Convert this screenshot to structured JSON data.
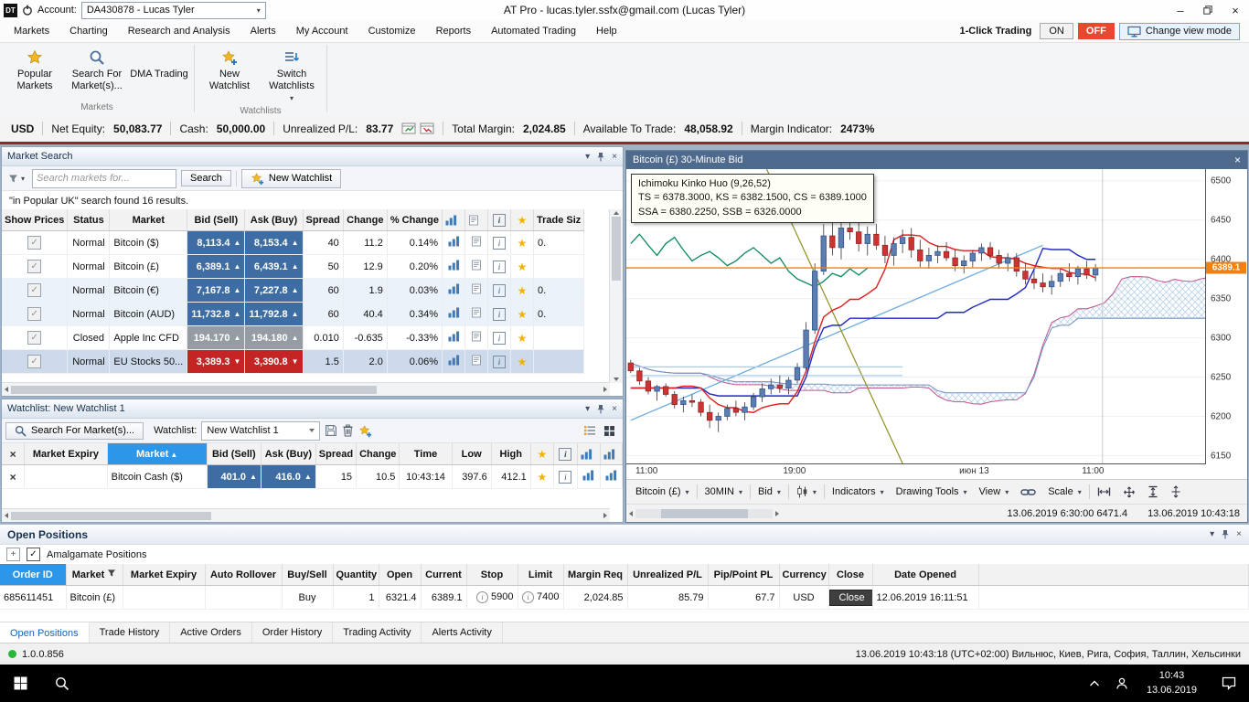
{
  "icons": {
    "up_triangle": "▲",
    "down_triangle": "▼",
    "dropdown_caret": "▾",
    "close": "×",
    "minimize": "–",
    "star": "★",
    "info": "i",
    "check": "✓",
    "plus": "+",
    "row_delete": "×"
  },
  "window": {
    "logo": "DT",
    "account_label": "Account:",
    "account_value": "DA430878 -  Lucas Tyler",
    "title": "AT Pro - lucas.tyler.ssfx@gmail.com (Lucas Tyler)"
  },
  "menubar": {
    "items": [
      "Markets",
      "Charting",
      "Research and Analysis",
      "Alerts",
      "My Account",
      "Customize",
      "Reports",
      "Automated Trading",
      "Help"
    ],
    "one_click_label": "1-Click Trading",
    "on_label": "ON",
    "off_label": "OFF",
    "change_view_label": "Change view mode"
  },
  "ribbon": {
    "groups": [
      "Markets",
      "Watchlists"
    ],
    "buttons": [
      {
        "label": "Popular Markets",
        "icon": "popular",
        "group": "Markets"
      },
      {
        "label": "Search For Market(s)...",
        "icon": "search",
        "group": "Markets"
      },
      {
        "label": "DMA Trading",
        "icon": "none",
        "group": "Markets"
      },
      {
        "label": "New Watchlist",
        "icon": "starplus",
        "group": "Watchlists"
      },
      {
        "label": "Switch Watchlists",
        "icon": "switch",
        "group": "Watchlists",
        "caret": true
      }
    ]
  },
  "account_bar": {
    "currency": "USD",
    "net_equity_label": "Net Equity:",
    "net_equity": "50,083.77",
    "cash_label": "Cash:",
    "cash": "50,000.00",
    "unrealized_label": "Unrealized P/L:",
    "unrealized": "83.77",
    "total_margin_label": "Total Margin:",
    "total_margin": "2,024.85",
    "available_label": "Available To Trade:",
    "available": "48,058.92",
    "margin_label": "Margin Indicator:",
    "margin": "2473%"
  },
  "market_search": {
    "title": "Market Search",
    "search_placeholder": "Search markets for...",
    "search_button": "Search",
    "new_watchlist_button": "New Watchlist",
    "result_text": "\"in Popular UK\" search found 16 results.",
    "columns": [
      "Show Prices",
      "Status",
      "Market",
      "Bid (Sell)",
      "Ask (Buy)",
      "Spread",
      "Change",
      "% Change",
      "",
      "",
      "",
      "",
      "Trade Siz"
    ],
    "rows": [
      {
        "status": "Normal",
        "market": "Bitcoin ($)",
        "bid": "8,113.4",
        "ask": "8,153.4",
        "dir": "up",
        "spread": "40",
        "change": "11.2",
        "pct": "0.14%",
        "trade": "0."
      },
      {
        "status": "Normal",
        "market": "Bitcoin (£)",
        "bid": "6,389.1",
        "ask": "6,439.1",
        "dir": "up",
        "spread": "50",
        "change": "12.9",
        "pct": "0.20%",
        "trade": ""
      },
      {
        "status": "Normal",
        "market": "Bitcoin (€)",
        "bid": "7,167.8",
        "ask": "7,227.8",
        "dir": "up",
        "spread": "60",
        "change": "1.9",
        "pct": "0.03%",
        "trade": "0.",
        "shaded": true
      },
      {
        "status": "Normal",
        "market": "Bitcoin (AUD)",
        "bid": "11,732.8",
        "ask": "11,792.8",
        "dir": "up",
        "spread": "60",
        "change": "40.4",
        "pct": "0.34%",
        "trade": "0.",
        "shaded": true
      },
      {
        "status": "Closed",
        "market": "Apple Inc CFD",
        "bid": "194.170",
        "ask": "194.180",
        "dir": "closed",
        "spread": "0.010",
        "change": "-0.635",
        "pct": "-0.33%",
        "trade": ""
      },
      {
        "status": "Normal",
        "market": "EU Stocks 50...",
        "bid": "3,389.3",
        "ask": "3,390.8",
        "dir": "down",
        "spread": "1.5",
        "change": "2.0",
        "pct": "0.06%",
        "trade": "",
        "selected": true
      }
    ]
  },
  "watchlist": {
    "title": "Watchlist: New Watchlist 1",
    "search_button": "Search For Market(s)...",
    "watchlist_label": "Watchlist:",
    "watchlist_value": "New Watchlist 1",
    "columns": [
      "",
      "Market Expiry",
      "Market",
      "Bid (Sell)",
      "Ask (Buy)",
      "Spread",
      "Change",
      "Time",
      "Low",
      "High"
    ],
    "rows": [
      {
        "expiry": "",
        "market": "Bitcoin Cash ($)",
        "bid": "401.0",
        "ask": "416.0",
        "dir": "up",
        "spread": "15",
        "change": "10.5",
        "time": "10:43:14",
        "low": "397.6",
        "high": "412.1"
      }
    ]
  },
  "chart": {
    "title": "Bitcoin (£) 30-Minute Bid",
    "tooltip": {
      "line1": "Ichimoku Kinko Huo (9,26,52)",
      "line2": "TS = 6378.3000, KS = 6382.1500, CS = 6389.1000",
      "line3": "SSA = 6380.2250, SSB = 6326.0000"
    },
    "price_label": "6389.1",
    "toolbar": {
      "market": "Bitcoin (£)",
      "timeframe": "30MIN",
      "price_type": "Bid",
      "indicators": "Indicators",
      "drawing_tools": "Drawing Tools",
      "view": "View",
      "scale": "Scale"
    },
    "status_left": "13.06.2019 6:30:00 6471.4",
    "status_right": "13.06.2019 10:43:18",
    "chart_data": {
      "type": "candlestick",
      "title": "Bitcoin (£) 30-Minute Bid",
      "indicator": "Ichimoku Kinko Huo (9,26,52)",
      "current_price": 6389.1,
      "ylim": [
        6140,
        6515
      ],
      "y_ticks": [
        6500,
        6450,
        6400,
        6350,
        6300,
        6250,
        6200,
        6150
      ],
      "x_labels": [
        {
          "label": "11:00",
          "pos": 0.035
        },
        {
          "label": "19:00",
          "pos": 0.29
        },
        {
          "label": "июн 13",
          "pos": 0.6
        },
        {
          "label": "11:00",
          "pos": 0.805
        }
      ],
      "total_slots": 66,
      "pre_candles": [
        [
          6270,
          6280,
          6255,
          6260
        ],
        [
          6260,
          6272,
          6248,
          6255
        ],
        [
          6255,
          6265,
          6240,
          6250
        ],
        [
          6250,
          6260,
          6235,
          6245
        ],
        [
          6245,
          6258,
          6232,
          6240
        ],
        [
          6240,
          6255,
          6230,
          6248
        ],
        [
          6248,
          6260,
          6238,
          6252
        ],
        [
          6252,
          6265,
          6242,
          6248
        ],
        [
          6248,
          6258,
          6232,
          6238
        ],
        [
          6238,
          6250,
          6225,
          6232
        ],
        [
          6232,
          6245,
          6218,
          6225
        ],
        [
          6225,
          6238,
          6212,
          6220
        ],
        [
          6220,
          6235,
          6208,
          6228
        ],
        [
          6228,
          6242,
          6218,
          6235
        ],
        [
          6235,
          6248,
          6222,
          6230
        ],
        [
          6230,
          6240,
          6215,
          6222
        ],
        [
          6222,
          6235,
          6210,
          6218
        ],
        [
          6218,
          6230,
          6205,
          6212
        ],
        [
          6212,
          6228,
          6202,
          6220
        ],
        [
          6220,
          6235,
          6210,
          6228
        ],
        [
          6228,
          6240,
          6215,
          6222
        ],
        [
          6222,
          6232,
          6208,
          6215
        ],
        [
          6215,
          6228,
          6205,
          6210
        ],
        [
          6210,
          6225,
          6200,
          6218
        ],
        [
          6218,
          6232,
          6208,
          6225
        ],
        [
          6225,
          6238,
          6212,
          6230
        ]
      ],
      "candles": [
        [
          6268,
          6272,
          6255,
          6258
        ],
        [
          6258,
          6262,
          6240,
          6245
        ],
        [
          6245,
          6250,
          6228,
          6232
        ],
        [
          6232,
          6240,
          6220,
          6238
        ],
        [
          6238,
          6242,
          6225,
          6228
        ],
        [
          6228,
          6232,
          6210,
          6215
        ],
        [
          6215,
          6225,
          6205,
          6220
        ],
        [
          6220,
          6228,
          6212,
          6218
        ],
        [
          6218,
          6222,
          6200,
          6205
        ],
        [
          6205,
          6215,
          6185,
          6195
        ],
        [
          6195,
          6205,
          6180,
          6200
        ],
        [
          6200,
          6215,
          6195,
          6210
        ],
        [
          6210,
          6220,
          6200,
          6205
        ],
        [
          6205,
          6218,
          6195,
          6212
        ],
        [
          6212,
          6230,
          6208,
          6225
        ],
        [
          6225,
          6242,
          6218,
          6235
        ],
        [
          6235,
          6248,
          6228,
          6240
        ],
        [
          6240,
          6252,
          6230,
          6236
        ],
        [
          6236,
          6250,
          6228,
          6246
        ],
        [
          6246,
          6268,
          6242,
          6262
        ],
        [
          6262,
          6320,
          6258,
          6310
        ],
        [
          6310,
          6395,
          6305,
          6385
        ],
        [
          6385,
          6445,
          6380,
          6430
        ],
        [
          6430,
          6452,
          6405,
          6415
        ],
        [
          6415,
          6448,
          6400,
          6440
        ],
        [
          6440,
          6470,
          6425,
          6435
        ],
        [
          6435,
          6455,
          6410,
          6420
        ],
        [
          6420,
          6442,
          6405,
          6432
        ],
        [
          6432,
          6445,
          6412,
          6418
        ],
        [
          6418,
          6430,
          6395,
          6405
        ],
        [
          6405,
          6428,
          6392,
          6420
        ],
        [
          6420,
          6438,
          6408,
          6428
        ],
        [
          6428,
          6440,
          6402,
          6412
        ],
        [
          6412,
          6425,
          6390,
          6398
        ],
        [
          6398,
          6415,
          6388,
          6405
        ],
        [
          6405,
          6418,
          6395,
          6410
        ],
        [
          6410,
          6422,
          6398,
          6402
        ],
        [
          6402,
          6412,
          6385,
          6392
        ],
        [
          6392,
          6405,
          6382,
          6398
        ],
        [
          6398,
          6412,
          6390,
          6408
        ],
        [
          6408,
          6420,
          6398,
          6415
        ],
        [
          6415,
          6422,
          6400,
          6405
        ],
        [
          6405,
          6412,
          6388,
          6395
        ],
        [
          6395,
          6408,
          6385,
          6402
        ],
        [
          6402,
          6408,
          6378,
          6385
        ],
        [
          6385,
          6395,
          6368,
          6375
        ],
        [
          6375,
          6386,
          6362,
          6370
        ],
        [
          6370,
          6382,
          6358,
          6365
        ],
        [
          6365,
          6380,
          6355,
          6372
        ],
        [
          6372,
          6388,
          6365,
          6382
        ],
        [
          6382,
          6395,
          6372,
          6378
        ],
        [
          6378,
          6392,
          6368,
          6388
        ],
        [
          6388,
          6398,
          6375,
          6380
        ],
        [
          6380,
          6394,
          6372,
          6389
        ]
      ],
      "drawings": [
        {
          "type": "hline",
          "price": 6389.1,
          "color": "#f08010",
          "width": 1.3
        },
        {
          "type": "segment",
          "s1": 0,
          "p1": 6195,
          "s2": 47,
          "p2": 6418,
          "color": "#68a8e0",
          "width": 1.2
        },
        {
          "type": "segment",
          "s1": 15.5,
          "p1": 6515,
          "s2": 31,
          "p2": 6140,
          "color": "#8f8f25",
          "width": 1.2
        },
        {
          "type": "segment",
          "s1": 0,
          "p1": 6252,
          "s2": 31,
          "p2": 6252,
          "color": "#a8cce8",
          "width": 1.2
        },
        {
          "type": "segment",
          "s1": 0,
          "p1": 6263,
          "s2": 31,
          "p2": 6263,
          "color": "#a8cce8",
          "width": 1.2
        },
        {
          "type": "vline",
          "slot": 53.8,
          "color": "#c8c8c8",
          "width": 1
        }
      ]
    }
  },
  "open_positions": {
    "title": "Open Positions",
    "amalgamate_label": "Amalgamate Positions",
    "columns": [
      "Order ID",
      "Market",
      "Market Expiry",
      "Auto Rollover",
      "Buy/Sell",
      "Quantity",
      "Open",
      "Current",
      "Stop",
      "Limit",
      "Margin Req",
      "Unrealized P/L",
      "Pip/Point PL",
      "Currency",
      "Close",
      "Date Opened"
    ],
    "rows": [
      {
        "order_id": "685611451",
        "market": "Bitcoin (£)",
        "expiry": "",
        "auto": "",
        "side": "Buy",
        "qty": "1",
        "open": "6321.4",
        "current": "6389.1",
        "stop": "5900",
        "limit": "7400",
        "margin": "2,024.85",
        "upl": "85.79",
        "pip": "67.7",
        "currency": "USD",
        "close": "Close",
        "date": "12.06.2019 16:11:51"
      }
    ],
    "tabs": [
      "Open Positions",
      "Trade History",
      "Active Orders",
      "Order History",
      "Trading Activity",
      "Alerts Activity"
    ],
    "active_tab": 0
  },
  "statusbar": {
    "version": "1.0.0.856",
    "right_text": "13.06.2019 10:43:18 (UTC+02:00) Вильнюс, Киев, Рига, София, Таллин, Хельсинки"
  },
  "taskbar": {
    "time": "10:43",
    "date": "13.06.2019"
  }
}
